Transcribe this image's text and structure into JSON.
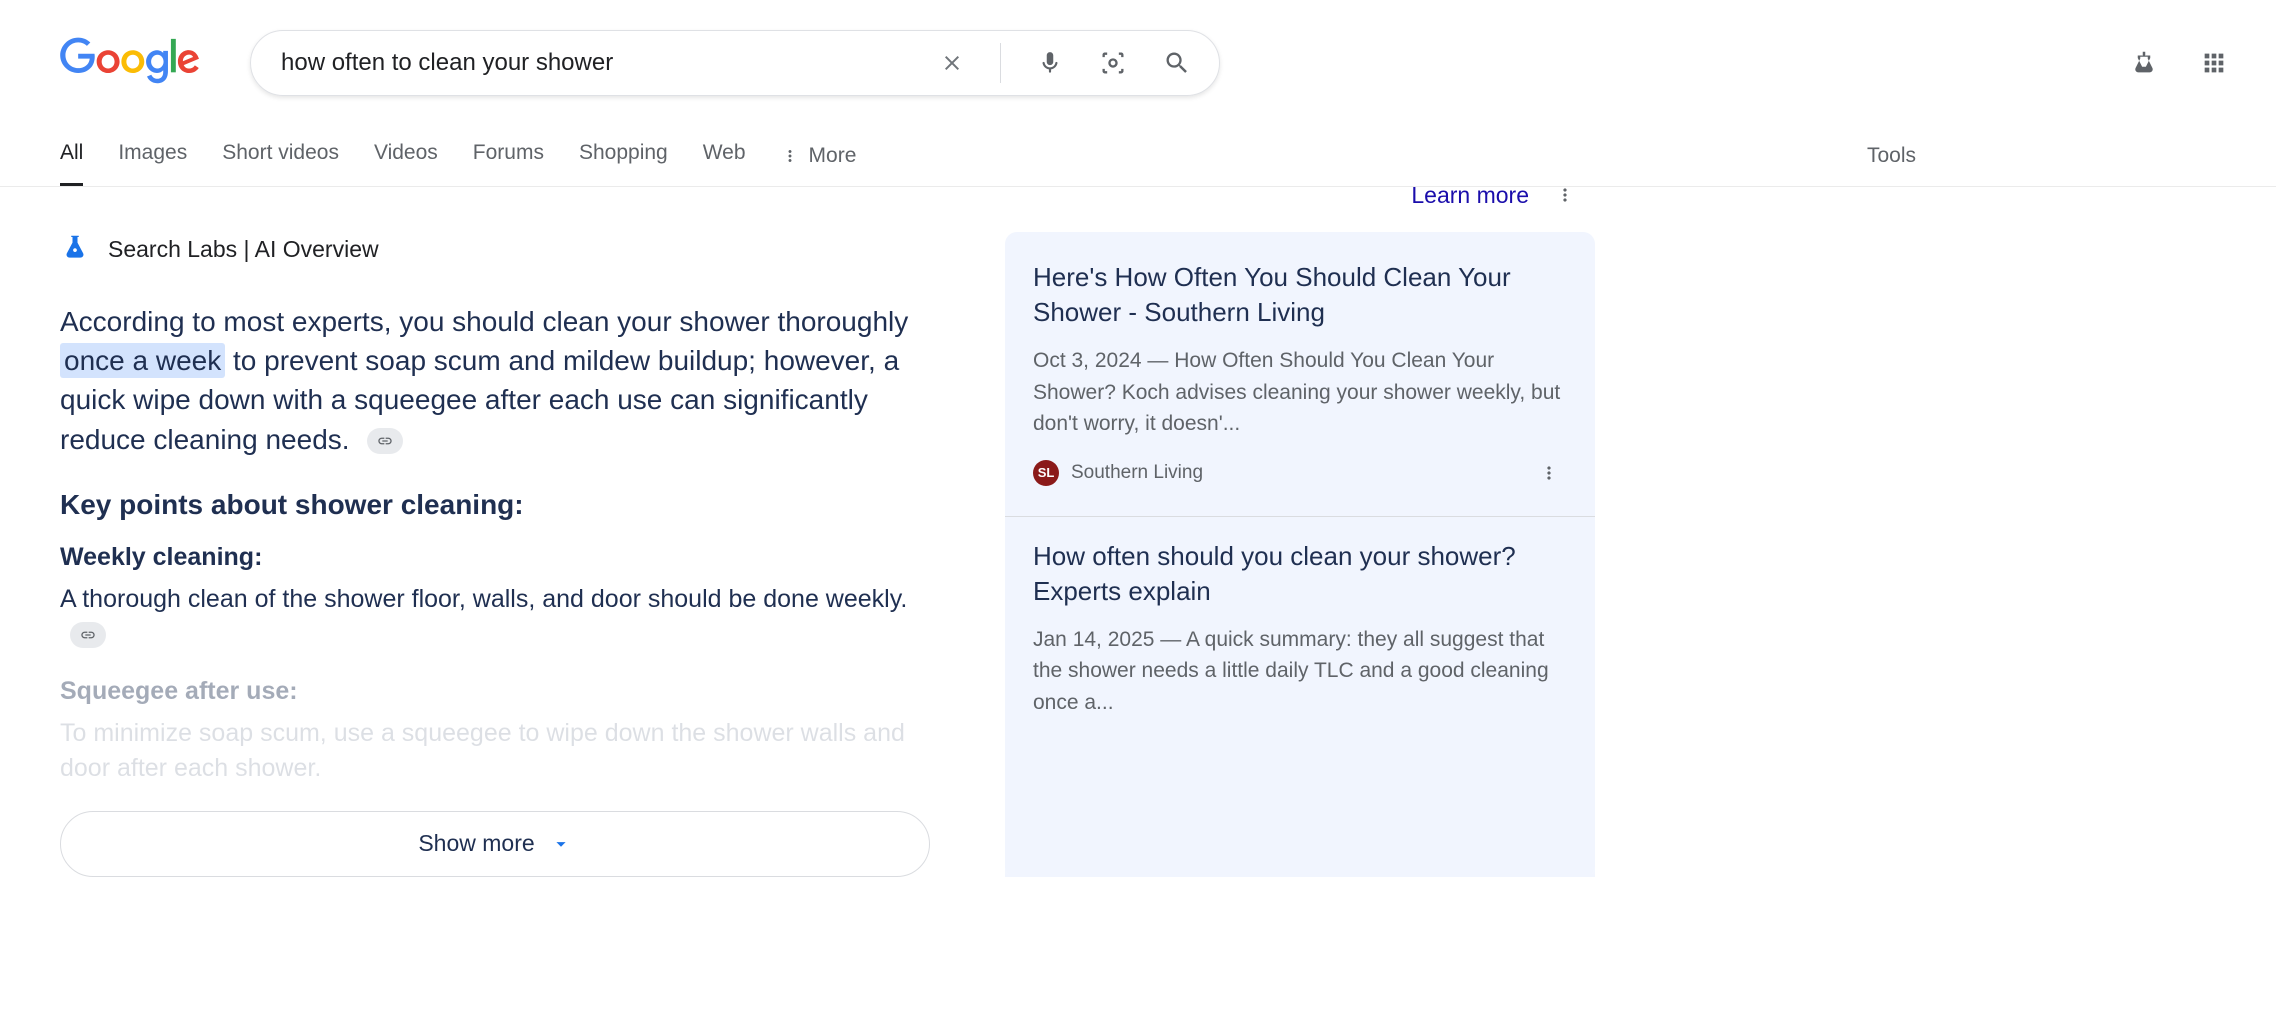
{
  "search": {
    "query": "how often to clean your shower"
  },
  "nav": {
    "tabs": [
      "All",
      "Images",
      "Short videos",
      "Videos",
      "Forums",
      "Shopping",
      "Web"
    ],
    "more": "More",
    "tools": "Tools"
  },
  "ai": {
    "label": "Search Labs | AI Overview",
    "learn_more": "Learn more",
    "text_pre": "According to most experts, you should clean your shower thoroughly ",
    "highlight": "once a week",
    "text_post": " to prevent soap scum and mildew buildup; however, a quick wipe down with a squeegee after each use can significantly reduce cleaning needs.",
    "key_heading": "Key points about shower cleaning:",
    "points": [
      {
        "heading": "Weekly cleaning:",
        "text": "A thorough clean of the shower floor, walls, and door should be done weekly."
      },
      {
        "heading": "Squeegee after use:",
        "text": "To minimize soap scum, use a squeegee to wipe down the shower walls and door after each shower."
      }
    ],
    "show_more": "Show more"
  },
  "results": [
    {
      "title": "Here's How Often You Should Clean Your Shower - Southern Living",
      "date": "Oct 3, 2024",
      "snippet": "How Often Should You Clean Your Shower? Koch advises cleaning your shower weekly, but don't worry, it doesn'...",
      "source": "Southern Living",
      "favicon_text": "SL"
    },
    {
      "title": "How often should you clean your shower? Experts explain",
      "date": "Jan 14, 2025",
      "snippet": "A quick summary: they all suggest that the shower needs a little daily TLC and a good cleaning once a..."
    }
  ]
}
